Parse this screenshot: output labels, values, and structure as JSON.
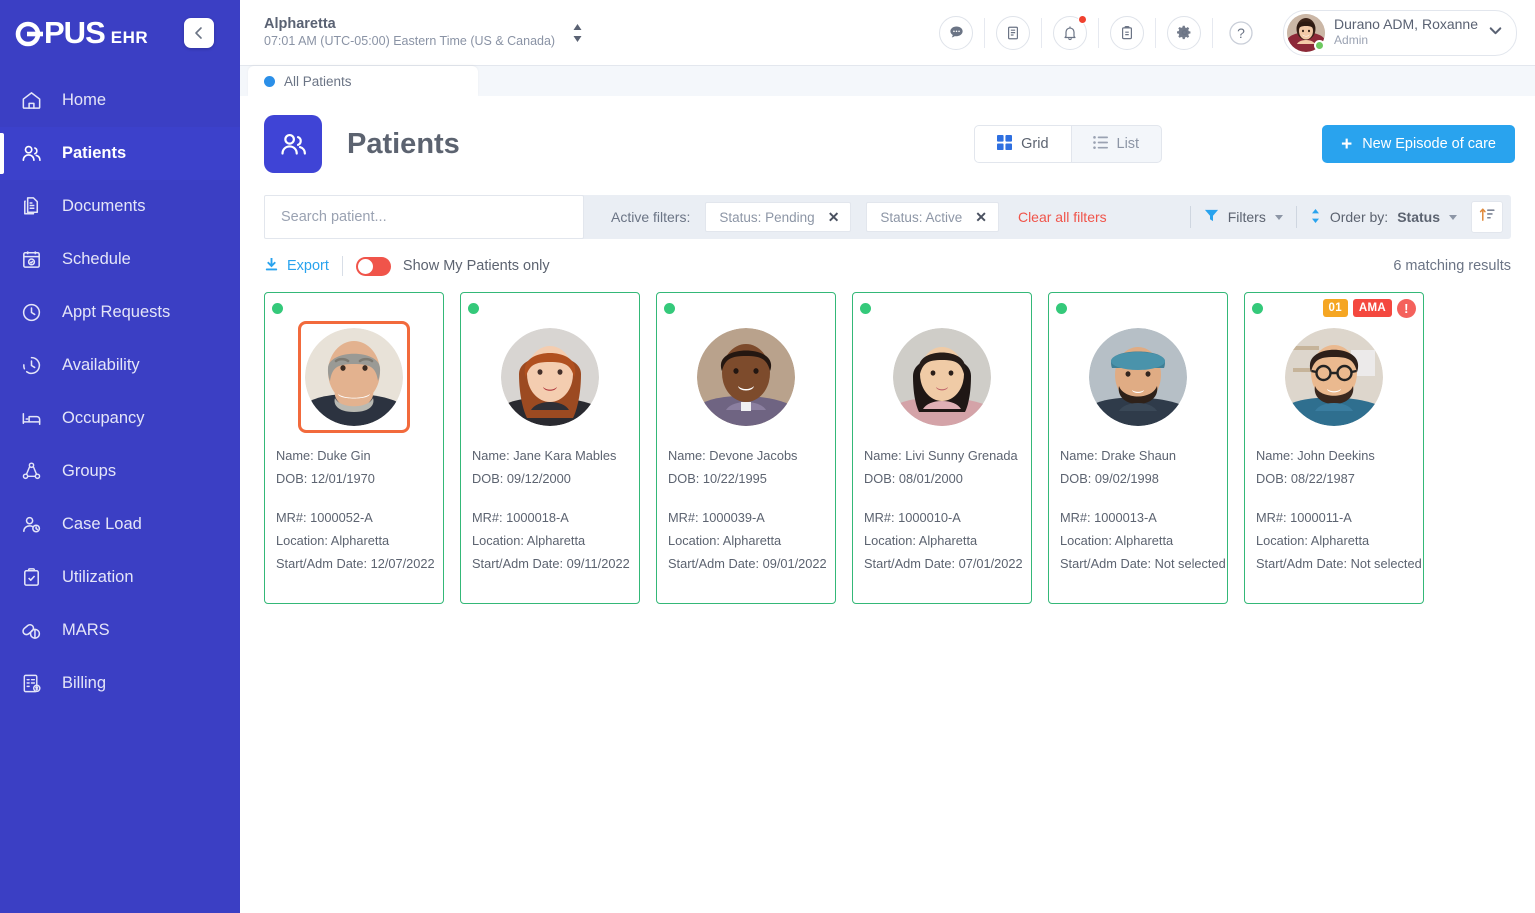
{
  "brand": {
    "logo_main": "PUS",
    "logo_sub": "EHR",
    "sidebar_color": "#3b3fc4",
    "accent_blue": "#29a3ee",
    "accent_red": "#f0544a",
    "accent_green": "#34b878"
  },
  "sidebar": {
    "collapse_icon": "arrow-left-icon",
    "items": [
      {
        "label": "Home",
        "icon": "home-icon",
        "active": false
      },
      {
        "label": "Patients",
        "icon": "patients-icon",
        "active": true
      },
      {
        "label": "Documents",
        "icon": "documents-icon",
        "active": false
      },
      {
        "label": "Schedule",
        "icon": "calendar-check-icon",
        "active": false
      },
      {
        "label": "Appt Requests",
        "icon": "clock-icon",
        "active": false
      },
      {
        "label": "Availability",
        "icon": "clock-dashed-icon",
        "active": false
      },
      {
        "label": "Occupancy",
        "icon": "bed-icon",
        "active": false
      },
      {
        "label": "Groups",
        "icon": "group-network-icon",
        "active": false
      },
      {
        "label": "Case Load",
        "icon": "user-clock-icon",
        "active": false
      },
      {
        "label": "Utilization",
        "icon": "clipboard-check-icon",
        "active": false
      },
      {
        "label": "MARS",
        "icon": "pills-icon",
        "active": false
      },
      {
        "label": "Billing",
        "icon": "billing-invoice-icon",
        "active": false
      }
    ]
  },
  "topbar": {
    "facility_name": "Alpharetta",
    "facility_timezone": "07:01 AM (UTC-05:00) Eastern Time (US & Canada)",
    "facility_switch_icon": "up-down-arrows-icon",
    "icons": [
      {
        "name": "chat-icon",
        "badge": false
      },
      {
        "name": "notes-icon",
        "badge": false
      },
      {
        "name": "bell-icon",
        "badge": true
      },
      {
        "name": "clipboard-icon",
        "badge": false
      },
      {
        "name": "gear-icon",
        "badge": false
      },
      {
        "name": "help-icon",
        "badge": false
      }
    ],
    "user": {
      "name": "Durano ADM, Roxanne",
      "role": "Admin",
      "avatar": "user-avatar",
      "status": "online",
      "chevron": "chevron-down-icon"
    }
  },
  "tabs": [
    {
      "label": "All Patients",
      "active": true,
      "dot_color": "#2b8fe8"
    }
  ],
  "page": {
    "title": "Patients",
    "icon": "patients-icon",
    "view_toggle": {
      "options": [
        {
          "label": "Grid",
          "icon": "grid-icon",
          "active": true
        },
        {
          "label": "List",
          "icon": "list-icon",
          "active": false
        }
      ]
    },
    "new_button": {
      "label": "New Episode of care",
      "icon": "plus-icon"
    }
  },
  "filters": {
    "search_placeholder": "Search patient...",
    "search_value": "",
    "active_filters_label": "Active filters:",
    "chips": [
      {
        "label": "Status: Pending"
      },
      {
        "label": "Status: Active"
      }
    ],
    "clear_all_label": "Clear all filters",
    "filters_button": {
      "label": "Filters",
      "icon": "funnel-icon"
    },
    "order_by": {
      "label": "Order by:",
      "value": "Status",
      "icon": "sort-arrows-icon"
    },
    "sort_button_icon": "sort-ascending-icon"
  },
  "toolbar": {
    "export_label": "Export",
    "export_icon": "download-icon",
    "my_patients_toggle": {
      "label": "Show My Patients only",
      "on": false
    },
    "results_text": "6 matching results"
  },
  "labels": {
    "name": "Name:",
    "dob": "DOB:",
    "mr": "MR#:",
    "location": "Location:",
    "start": "Start/Adm Date:"
  },
  "patients": [
    {
      "name": "Duke Gin",
      "dob": "12/01/1970",
      "mr": "1000052-A",
      "location": "Alpharetta",
      "start_date": "12/07/2022",
      "status_dot": "#34c97a",
      "selected": true,
      "badges": []
    },
    {
      "name": "Jane Kara Mables",
      "dob": "09/12/2000",
      "mr": "1000018-A",
      "location": "Alpharetta",
      "start_date": "09/11/2022",
      "status_dot": "#34c97a",
      "selected": false,
      "badges": []
    },
    {
      "name": "Devone Jacobs",
      "dob": "10/22/1995",
      "mr": "1000039-A",
      "location": "Alpharetta",
      "start_date": "09/01/2022",
      "status_dot": "#34c97a",
      "selected": false,
      "badges": []
    },
    {
      "name": "Livi Sunny Grenada",
      "dob": "08/01/2000",
      "mr": "1000010-A",
      "location": "Alpharetta",
      "start_date": "07/01/2022",
      "status_dot": "#34c97a",
      "selected": false,
      "badges": []
    },
    {
      "name": "Drake Shaun",
      "dob": "09/02/1998",
      "mr": "1000013-A",
      "location": "Alpharetta",
      "start_date": "Not selected",
      "status_dot": "#34c97a",
      "selected": false,
      "badges": []
    },
    {
      "name": "John Deekins",
      "dob": "08/22/1987",
      "mr": "1000011-A",
      "location": "Alpharetta",
      "start_date": "Not selected",
      "status_dot": "#34c97a",
      "selected": false,
      "badges": [
        {
          "type": "num",
          "label": "01",
          "color": "#f5a623"
        },
        {
          "type": "ama",
          "label": "AMA",
          "color": "#f4483f"
        },
        {
          "type": "excl",
          "label": "!",
          "color": "#f4615c"
        }
      ]
    }
  ]
}
